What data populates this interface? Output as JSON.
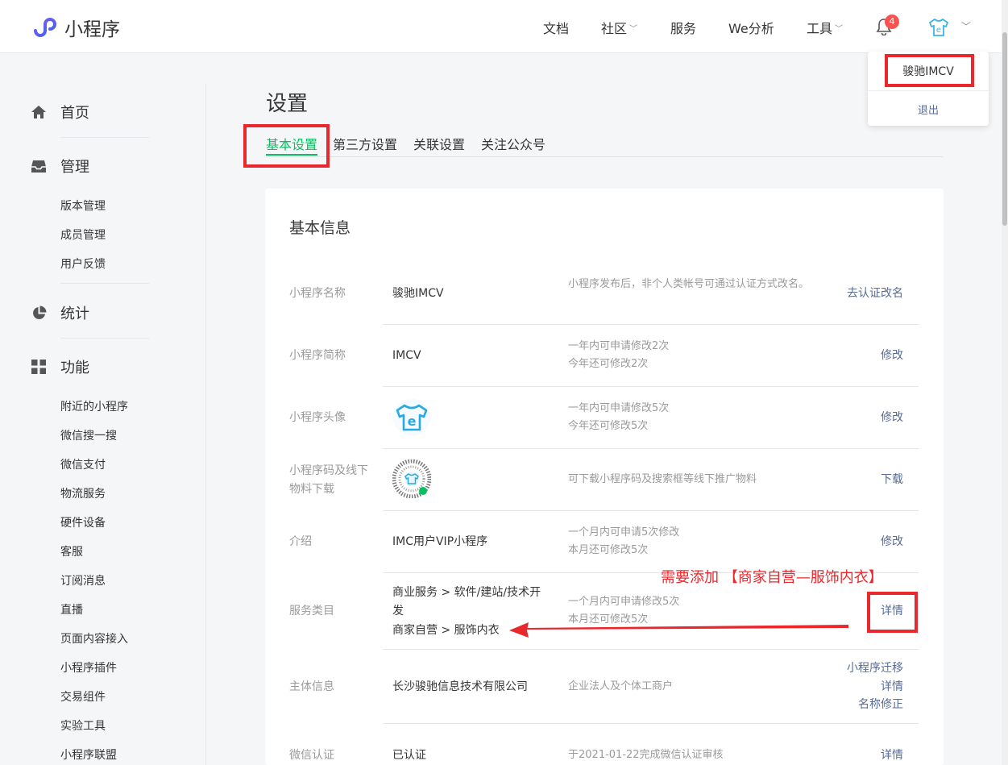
{
  "header": {
    "app_name": "小程序",
    "nav": [
      {
        "label": "文档"
      },
      {
        "label": "社区"
      },
      {
        "label": "服务"
      },
      {
        "label": "We分析"
      },
      {
        "label": "工具"
      }
    ],
    "notification_count": "4"
  },
  "account_menu": {
    "name": "骏驰IMCV",
    "logout": "退出"
  },
  "sidebar": {
    "home": "首页",
    "manage": "管理",
    "manage_items": [
      "版本管理",
      "成员管理",
      "用户反馈"
    ],
    "stats": "统计",
    "features": "功能",
    "feature_items": [
      "附近的小程序",
      "微信搜一搜",
      "微信支付",
      "物流服务",
      "硬件设备",
      "客服",
      "订阅消息",
      "直播",
      "页面内容接入",
      "小程序插件",
      "交易组件",
      "实验工具",
      "小程序联盟"
    ]
  },
  "main": {
    "title": "设置",
    "tabs": [
      "基本设置",
      "第三方设置",
      "关联设置",
      "关注公众号"
    ],
    "section_title": "基本信息",
    "rows": {
      "name": {
        "label": "小程序名称",
        "value": "骏驰IMCV",
        "tip": "小程序发布后，非个人类帐号可通过认证方式改名。",
        "action": "去认证改名"
      },
      "short": {
        "label": "小程序简称",
        "value": "IMCV",
        "tip1": "一年内可申请修改2次",
        "tip2": "今年还可修改2次",
        "action": "修改"
      },
      "avatar": {
        "label": "小程序头像",
        "tip1": "一年内可申请修改5次",
        "tip2": "今年还可修改5次",
        "action": "修改"
      },
      "qrcode": {
        "label1": "小程序码及线下",
        "label2": "物料下载",
        "tip": "可下载小程序码及搜索框等线下推广物料",
        "action": "下载"
      },
      "intro": {
        "label": "介绍",
        "value": "IMC用户VIP小程序",
        "tip1": "一个月内可申请5次修改",
        "tip2": "本月还可修改5次",
        "action": "修改"
      },
      "category": {
        "label": "服务类目",
        "value1a": "商业服务 > 软件/建站/技术开",
        "value1b": "发",
        "value2": "商家自营 > 服饰内衣",
        "tip1": "一个月内可申请修改5次",
        "tip2": "本月还可修改5次",
        "action": "详情"
      },
      "subject": {
        "label": "主体信息",
        "value": "长沙骏驰信息技术有限公司",
        "tip": "企业法人及个体工商户",
        "actions": [
          "小程序迁移",
          "详情",
          "名称修正"
        ]
      },
      "verify": {
        "label": "微信认证",
        "value": "已认证",
        "tip": "于2021-01-22完成微信认证审核",
        "action": "详情"
      }
    }
  },
  "annotation": {
    "note": "需要添加 【商家自营—服饰内衣】",
    "color": "#e9282d"
  },
  "colors": {
    "accent": "#07c160",
    "link": "#576b95",
    "badge": "#fa5151"
  }
}
